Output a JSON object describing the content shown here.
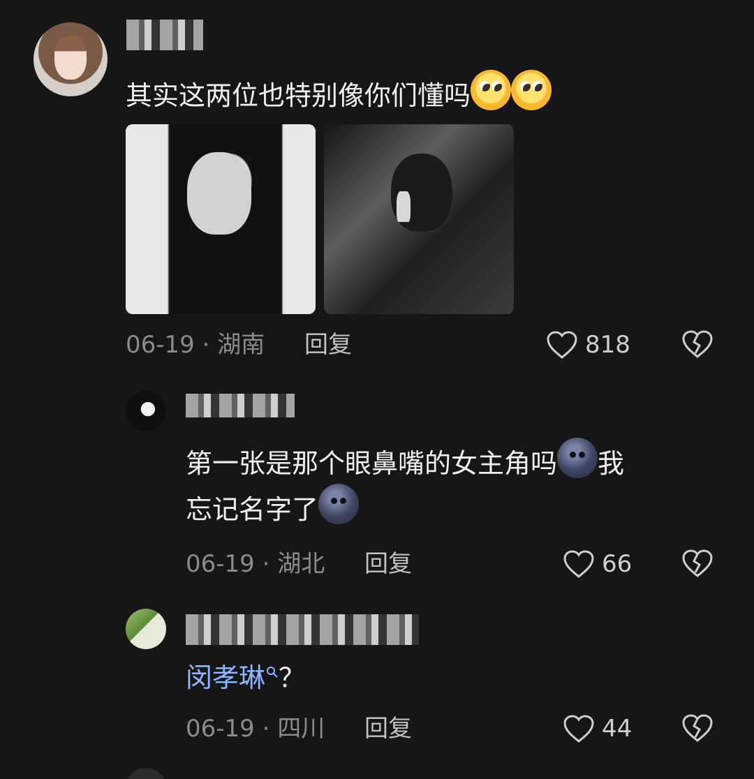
{
  "comments": [
    {
      "text": "其实这两位也特别像你们懂吗",
      "emoji_names": [
        "pleading-face-icon",
        "pleading-face-icon"
      ],
      "date_location": "06-19 · 湖南",
      "reply": "回复",
      "likes": "818"
    },
    {
      "text_part1": "第一张是那个眼鼻嘴的女主角吗",
      "text_part2": "我\n忘记名字了",
      "emoji_names": [
        "moon-face-icon",
        "moon-face-icon"
      ],
      "date_location": "06-19 · 湖北",
      "reply": "回复",
      "likes": "66"
    },
    {
      "link_text": "闵孝琳",
      "suffix": "？",
      "date_location": "06-19 · 四川",
      "reply": "回复",
      "likes": "44"
    }
  ],
  "colors": {
    "background": "#161616",
    "text": "#f0f0f0",
    "meta": "#8b8b8b",
    "link": "#8fb5ff"
  }
}
